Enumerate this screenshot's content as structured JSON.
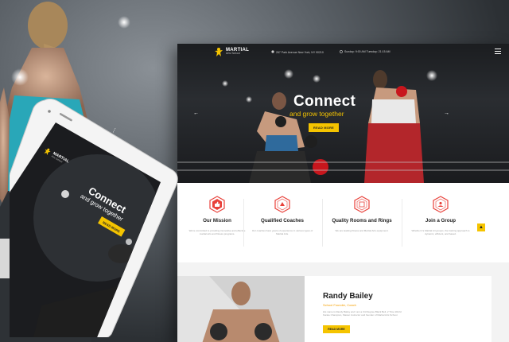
{
  "brand": {
    "name": "MARTIAL",
    "tagline": "Arts School"
  },
  "nav": {
    "address": "267 Park Avenue New York, NY 90210",
    "hours": "Sunday: 9:00 AM Tuesday: 21:15 AM"
  },
  "hero": {
    "title": "Connect",
    "subtitle": "and grow together",
    "button": "READ MORE"
  },
  "features": [
    {
      "title": "Our Mission",
      "text": "We're committed to providing innovative and effective martial arts and fitness programs.",
      "icon": "thumbs-up-icon"
    },
    {
      "title": "Qualified Coaches",
      "text": "Our coaches have years of experience in various types of Martial Arts.",
      "icon": "coach-icon"
    },
    {
      "title": "Quality Rooms and Rings",
      "text": "We are leading fitness and Martial Arts equipment.",
      "icon": "ring-icon"
    },
    {
      "title": "Join a Group",
      "text": "Whether it's Martial Art groups, the training approach is dynamic, efficient, and based.",
      "icon": "group-icon"
    }
  ],
  "scroll_top": "▲",
  "coach": {
    "name": "Randy Bailey",
    "role": "School Founder, Coach",
    "bio": "His name is Randy Bailey and I am a 3rd Degree Black Belt, 2 Time World Karate Champion, Master instructor and founder of Martial Arts School.",
    "button": "READ MORE"
  },
  "mobile": {
    "brand": "MARTIAL",
    "tagline": "Arts School",
    "title": "Connect",
    "subtitle": "and grow together",
    "button": "READ MORE"
  },
  "colors": {
    "accent": "#f5c400",
    "feature_icon": "#e8413a",
    "dark": "#1b1d20"
  }
}
